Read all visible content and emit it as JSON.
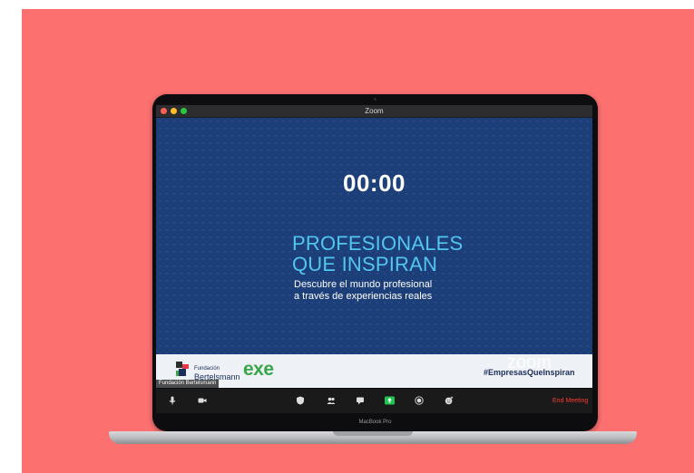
{
  "window": {
    "title": "Zoom"
  },
  "presentation": {
    "timer": "00:00",
    "headline_line1": "PROFESIONALES",
    "headline_line2": "QUE INSPIRAN",
    "subtitle_line1": "Descubre el mundo profesional",
    "subtitle_line2": "a través de experiencias reales"
  },
  "branding": {
    "fundacion_small": "Fundación",
    "fundacion_big": "Bertelsmann",
    "exe": "exe",
    "zoom_watermark": "zoom",
    "hashtag": "#EmpresasQueInspiran"
  },
  "participant": {
    "name": "Fundación Bertelsmann"
  },
  "toolbar": {
    "icons": [
      "microphone-icon",
      "video-camera-icon",
      "security-icon",
      "participants-icon",
      "chat-icon",
      "share-screen-icon",
      "record-icon",
      "reactions-icon"
    ],
    "end_label": "End Meeting"
  },
  "device": {
    "label": "MacBook Pro"
  },
  "colors": {
    "background": "#fc7070",
    "slide": "#1c3f79",
    "headline": "#52c6ee",
    "share_accent": "#23c552",
    "end_meeting": "#ff3b30",
    "exe_green": "#3aa64a"
  }
}
